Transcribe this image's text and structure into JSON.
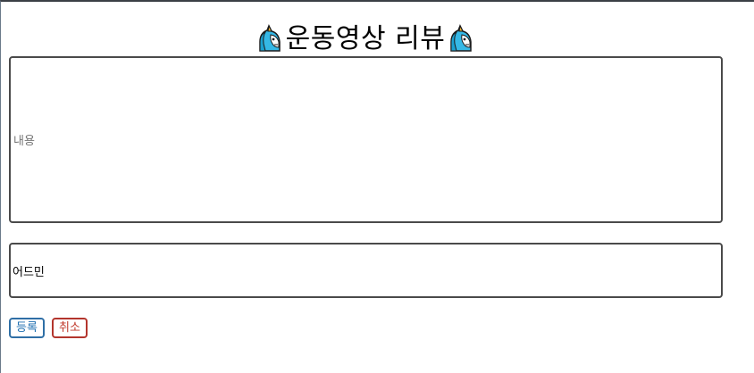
{
  "page": {
    "title": "운동영상 리뷰",
    "title_icon": "unicorn-icon"
  },
  "form": {
    "content_placeholder": "내용",
    "author_value": "어드민"
  },
  "actions": {
    "register_label": "등록",
    "cancel_label": "취소"
  },
  "colors": {
    "register": "#1f6fb0",
    "cancel": "#c0392b",
    "field_border": "#4a4a4a"
  }
}
